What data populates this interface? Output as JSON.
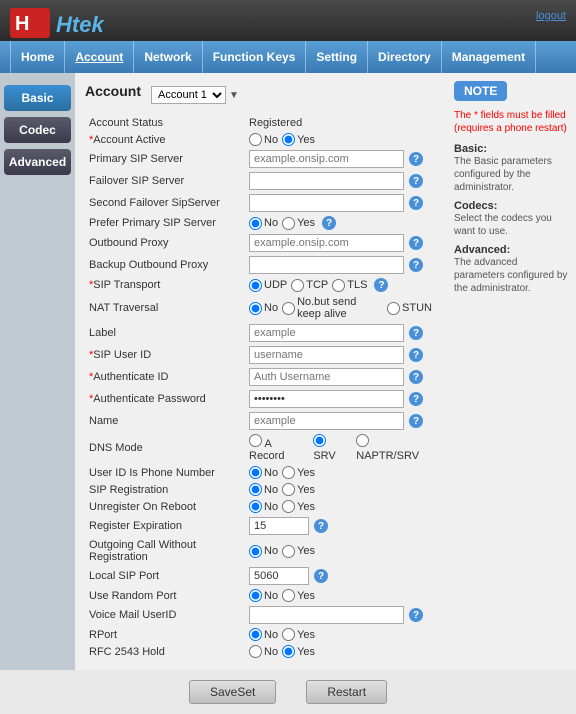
{
  "header": {
    "logout_label": "logout",
    "logo_text": "Htek"
  },
  "nav": {
    "items": [
      {
        "label": "Home"
      },
      {
        "label": "Account",
        "active": true
      },
      {
        "label": "Network"
      },
      {
        "label": "Function Keys"
      },
      {
        "label": "Setting"
      },
      {
        "label": "Directory"
      },
      {
        "label": "Management"
      }
    ]
  },
  "sidebar": {
    "basic_label": "Basic",
    "codec_label": "Codec",
    "advanced_label": "Advanced"
  },
  "content": {
    "title": "Account",
    "account_select": "Account 1",
    "fields": [
      {
        "label": "Account Status",
        "value": "Registered",
        "type": "text"
      },
      {
        "label": "Account Active",
        "type": "radio_no_yes",
        "required": true,
        "selected": "Yes"
      },
      {
        "label": "Primary SIP Server",
        "type": "input",
        "placeholder": "example.onsip.com",
        "required": false
      },
      {
        "label": "Failover SIP Server",
        "type": "input",
        "placeholder": "",
        "required": false
      },
      {
        "label": "Second Failover SipServer",
        "type": "input",
        "placeholder": "",
        "required": false
      },
      {
        "label": "Prefer Primary SIP Server",
        "type": "radio_no_yes_help",
        "selected": "No"
      },
      {
        "label": "Outbound Proxy",
        "type": "input",
        "placeholder": "example.onsip.com"
      },
      {
        "label": "Backup Outbound Proxy",
        "type": "input",
        "placeholder": ""
      },
      {
        "label": "SIP Transport",
        "type": "radio_udp_tcp_tls",
        "selected": "UDP",
        "required": true
      },
      {
        "label": "NAT Traversal",
        "type": "radio_nat"
      },
      {
        "label": "Label",
        "type": "input",
        "placeholder": "example"
      },
      {
        "label": "SIP User ID",
        "type": "input_help",
        "placeholder": "username",
        "required": true
      },
      {
        "label": "Authenticate ID",
        "type": "input_help",
        "placeholder": "Auth Username",
        "required": true
      },
      {
        "label": "Authenticate Password",
        "type": "password_help",
        "placeholder": "••••••••",
        "required": true
      },
      {
        "label": "Name",
        "type": "input_help",
        "placeholder": "example"
      },
      {
        "label": "DNS Mode",
        "type": "radio_dns"
      },
      {
        "label": "User ID Is Phone Number",
        "type": "radio_no_yes",
        "selected": "No"
      },
      {
        "label": "SIP Registration",
        "type": "radio_no_yes",
        "selected": "No"
      },
      {
        "label": "Unregister On Reboot",
        "type": "radio_no_yes",
        "selected": "No"
      },
      {
        "label": "Register Expiration",
        "type": "input_sm_help",
        "placeholder": "15"
      },
      {
        "label": "Outgoing Call Without Registration",
        "type": "radio_no_yes",
        "selected": "No"
      },
      {
        "label": "Local SIP Port",
        "type": "input_sm_help",
        "placeholder": "5060"
      },
      {
        "label": "Use Random Port",
        "type": "radio_no_yes",
        "selected": "No"
      },
      {
        "label": "Voice Mail UserID",
        "type": "input_help",
        "placeholder": ""
      },
      {
        "label": "RPort",
        "type": "radio_no_yes",
        "selected": "No"
      },
      {
        "label": "RFC 2543 Hold",
        "type": "radio_no_yes",
        "selected": "Yes"
      }
    ]
  },
  "note": {
    "badge": "NOTE",
    "warning": "The * fields must be filled (requires a phone restart)",
    "sections": [
      {
        "title": "Basic:",
        "text": "The Basic parameters configured by the administrator."
      },
      {
        "title": "Codecs:",
        "text": "Select the codecs you want to use."
      },
      {
        "title": "Advanced:",
        "text": "The advanced parameters configured by the administrator."
      }
    ]
  },
  "footer": {
    "save_label": "SaveSet",
    "restart_label": "Restart"
  }
}
